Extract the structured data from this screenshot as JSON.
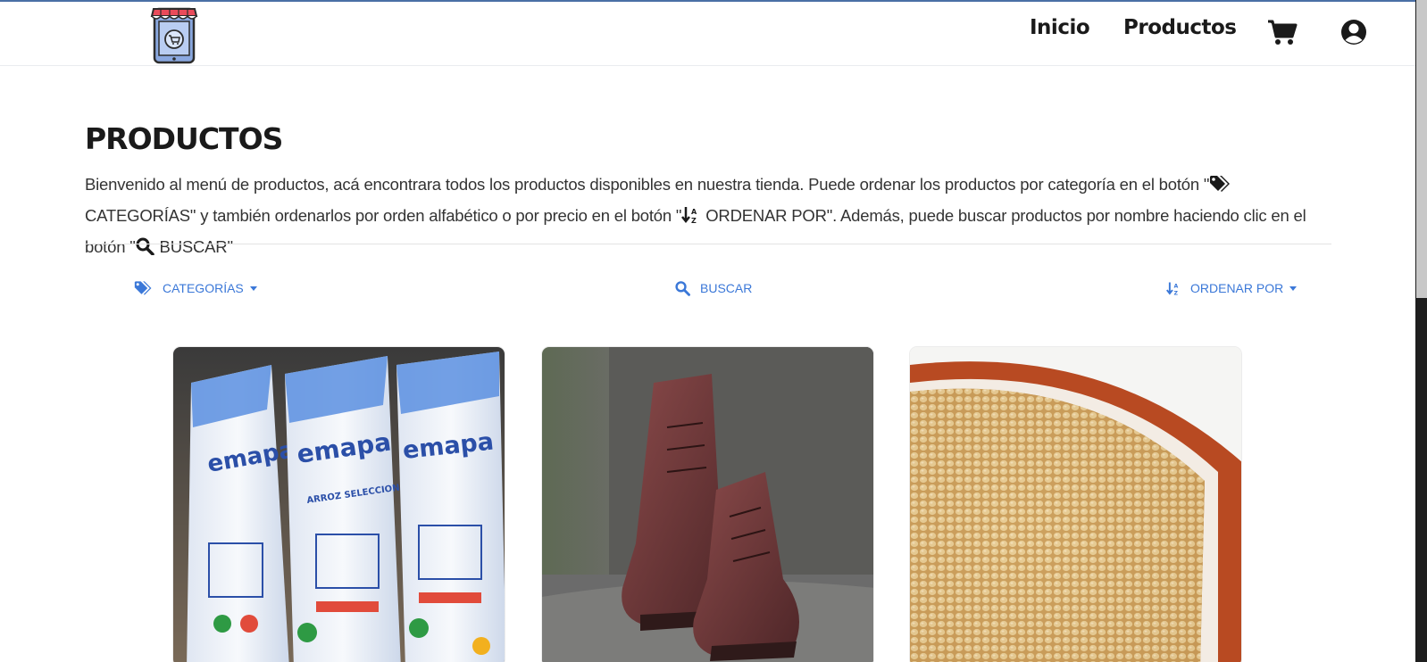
{
  "nav": {
    "items": [
      {
        "label": "Inicio"
      },
      {
        "label": "Productos"
      }
    ],
    "icons": [
      "cart-icon",
      "user-icon"
    ],
    "logo": "shop-logo"
  },
  "page": {
    "title": "PRODUCTOS",
    "intro": {
      "part1": "Bienvenido al menú de productos, acá encontrara todos los productos disponibles en nuestra tienda. Puede ordenar los productos por categoría en el botón \"",
      "part2": " CATEGORÍAS\" y también ordenarlos por orden alfabético o por precio en el botón \"",
      "part3": " ORDENAR POR\". Además, puede buscar productos por nombre haciendo clic en el botón \"",
      "part4": "   BUSCAR\""
    }
  },
  "toolbar": {
    "categorias": "Categorías",
    "buscar": "Buscar",
    "ordenar": "Ordenar por"
  },
  "products": [
    {
      "image": "rice-bags"
    },
    {
      "image": "brown-boots"
    },
    {
      "image": "quinoa-bowl"
    }
  ],
  "colors": {
    "accent": "#3b78d8",
    "text": "#1a1a1a"
  }
}
